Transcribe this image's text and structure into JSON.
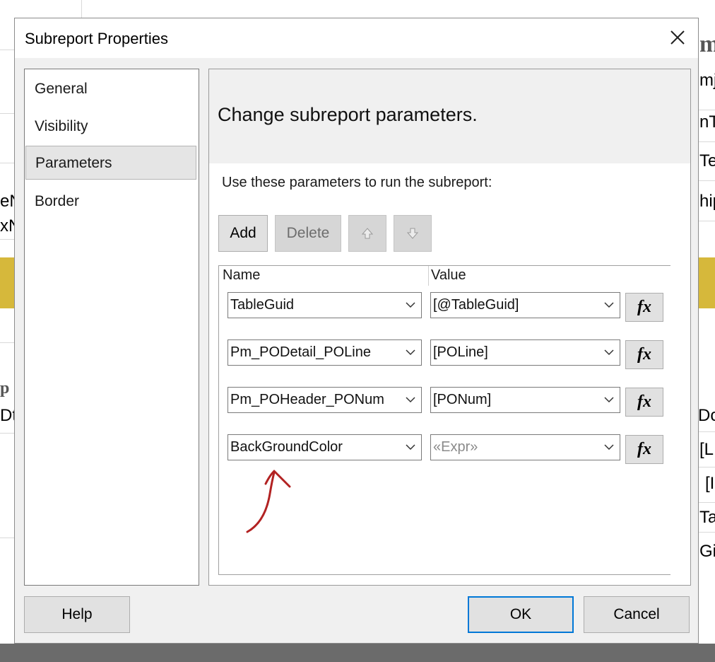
{
  "background": {
    "fragments": [
      {
        "text": "m"
      },
      {
        "text": "mj"
      },
      {
        "text": "nT"
      },
      {
        "text": "Te"
      },
      {
        "text": "hip"
      },
      {
        "text": "eN"
      },
      {
        "text": "xN"
      },
      {
        "text": "p"
      },
      {
        "text": "Dt"
      },
      {
        "text": "Do"
      },
      {
        "text": "[L"
      },
      {
        "text": "[I"
      },
      {
        "text": "Ta"
      },
      {
        "text": "Gi"
      }
    ]
  },
  "dialog": {
    "title": "Subreport Properties",
    "close_icon": "close-icon"
  },
  "nav": {
    "items": [
      {
        "label": "General",
        "selected": false
      },
      {
        "label": "Visibility",
        "selected": false
      },
      {
        "label": "Parameters",
        "selected": true
      },
      {
        "label": "Border",
        "selected": false
      }
    ]
  },
  "panel": {
    "title": "Change subreport parameters.",
    "instructions": "Use these parameters to run the subreport:",
    "toolbar": {
      "add_label": "Add",
      "delete_label": "Delete",
      "move_up_icon": "arrow-up-icon",
      "move_down_icon": "arrow-down-icon"
    },
    "grid": {
      "columns": [
        "Name",
        "Value"
      ],
      "rows": [
        {
          "name": "TableGuid",
          "value": "[@TableGuid]",
          "value_placeholder": false
        },
        {
          "name": "Pm_PODetail_POLine",
          "value": "[POLine]",
          "value_placeholder": false
        },
        {
          "name": "Pm_POHeader_PONum",
          "value": "[PONum]",
          "value_placeholder": false
        },
        {
          "name": "BackGroundColor",
          "value": "«Expr»",
          "value_placeholder": true
        }
      ],
      "expression_button_label": "fx"
    },
    "annotation_color": "#b22222"
  },
  "footer": {
    "help_label": "Help",
    "ok_label": "OK",
    "cancel_label": "Cancel"
  },
  "colors": {
    "accent": "#0078d7",
    "band": "#d6b83b"
  }
}
